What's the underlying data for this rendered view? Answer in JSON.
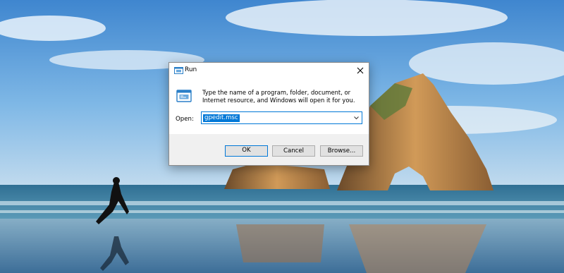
{
  "dialog": {
    "title": "Run",
    "description": "Type the name of a program, folder, document, or Internet resource, and Windows will open it for you.",
    "open_label": "Open:",
    "open_value": "gpedit.msc",
    "buttons": {
      "ok": "OK",
      "cancel": "Cancel",
      "browse": "Browse..."
    }
  },
  "icons": [
    "run-app-icon",
    "close-icon",
    "chevron-down-icon"
  ],
  "colors": {
    "accent": "#0078d7",
    "dialog_bg": "#ffffff",
    "footer_bg": "#f0f0f0",
    "button_bg": "#e1e1e1"
  }
}
